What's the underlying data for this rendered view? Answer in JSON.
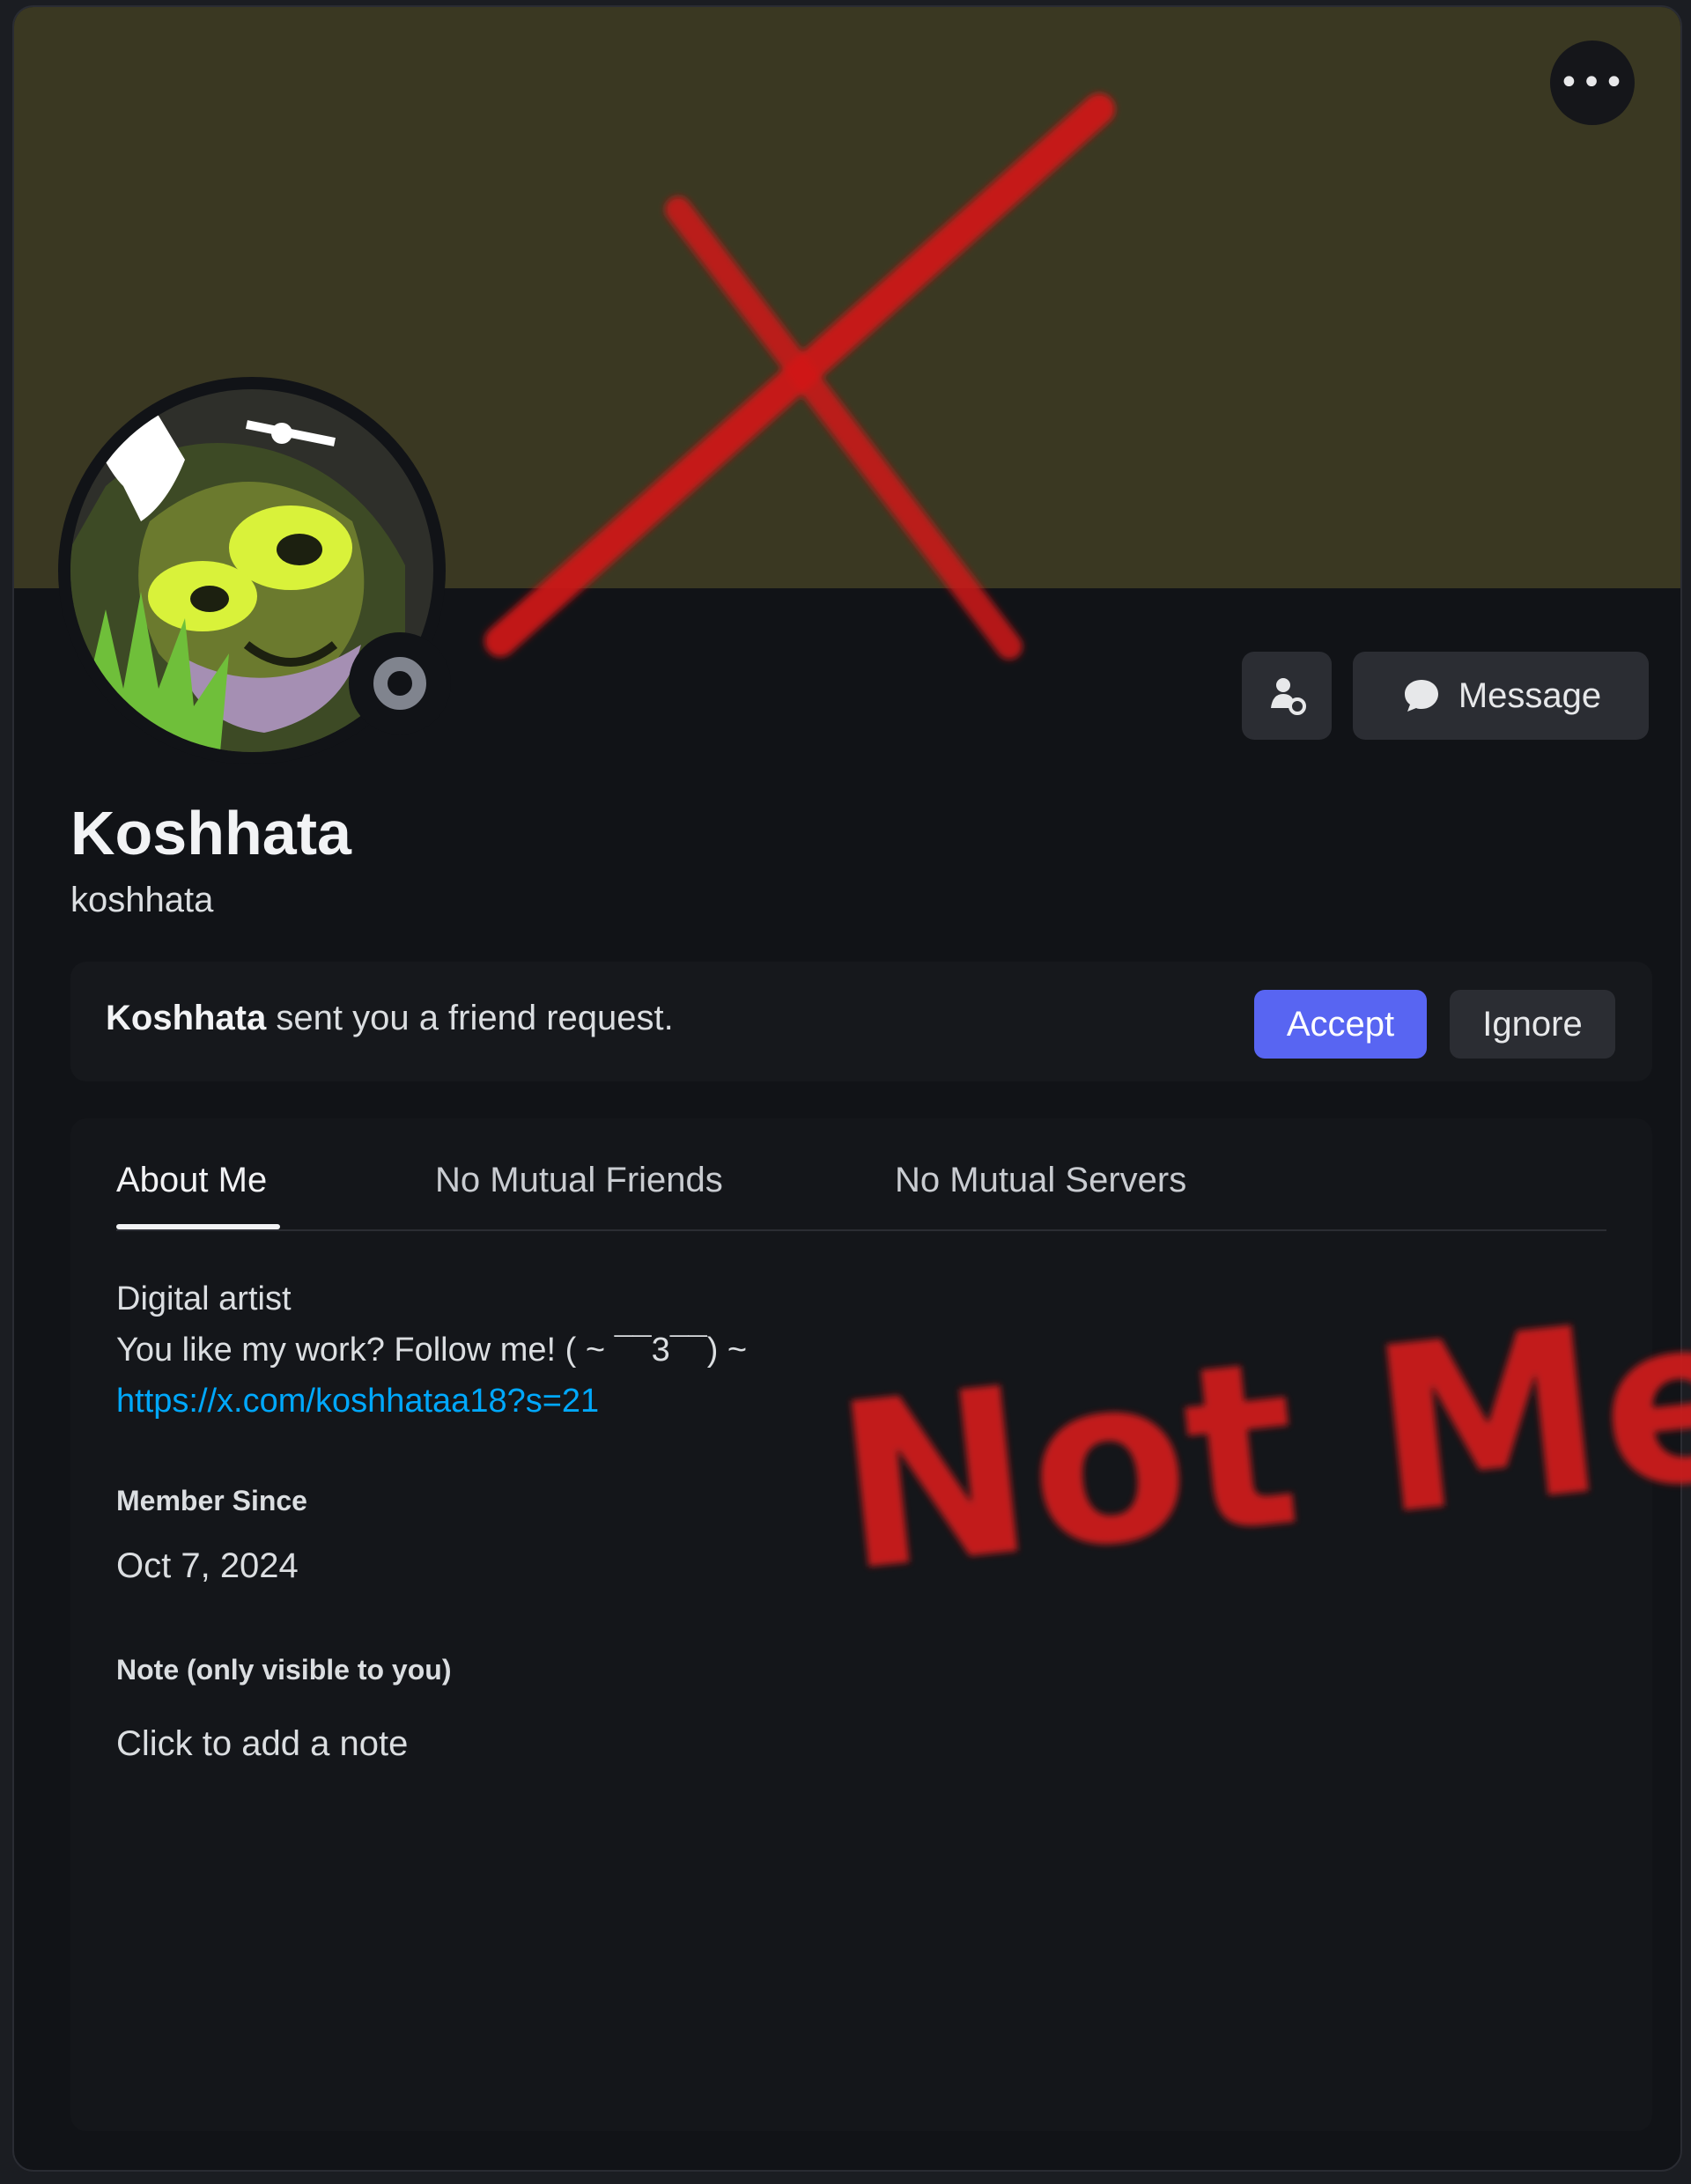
{
  "profile": {
    "display_name": "Koshhata",
    "username": "koshhata",
    "banner_color": "#3a3822",
    "status": "offline"
  },
  "header": {
    "more_label": "•••"
  },
  "actions": {
    "message_label": "Message",
    "friend_icon": "add-friend-pending-icon",
    "message_icon": "chat-bubble-icon"
  },
  "friend_request": {
    "sender": "Koshhata",
    "text": " sent you a friend request.",
    "accept_label": "Accept",
    "ignore_label": "Ignore"
  },
  "tabs": [
    {
      "label": "About Me",
      "active": true
    },
    {
      "label": "No Mutual Friends",
      "active": false
    },
    {
      "label": "No Mutual Servers",
      "active": false
    }
  ],
  "about": {
    "line1": "Digital artist",
    "line2": "You like my work? Follow me! ( ~ ¯¯3¯¯) ~",
    "link": "https://x.com/koshhataa18?s=21"
  },
  "member_since": {
    "heading": "Member Since",
    "value": "Oct 7, 2024"
  },
  "note": {
    "heading": "Note (only visible to you)",
    "placeholder": "Click to add a note"
  },
  "annotation": {
    "text": "Not Me!",
    "color": "#d11a1a"
  }
}
